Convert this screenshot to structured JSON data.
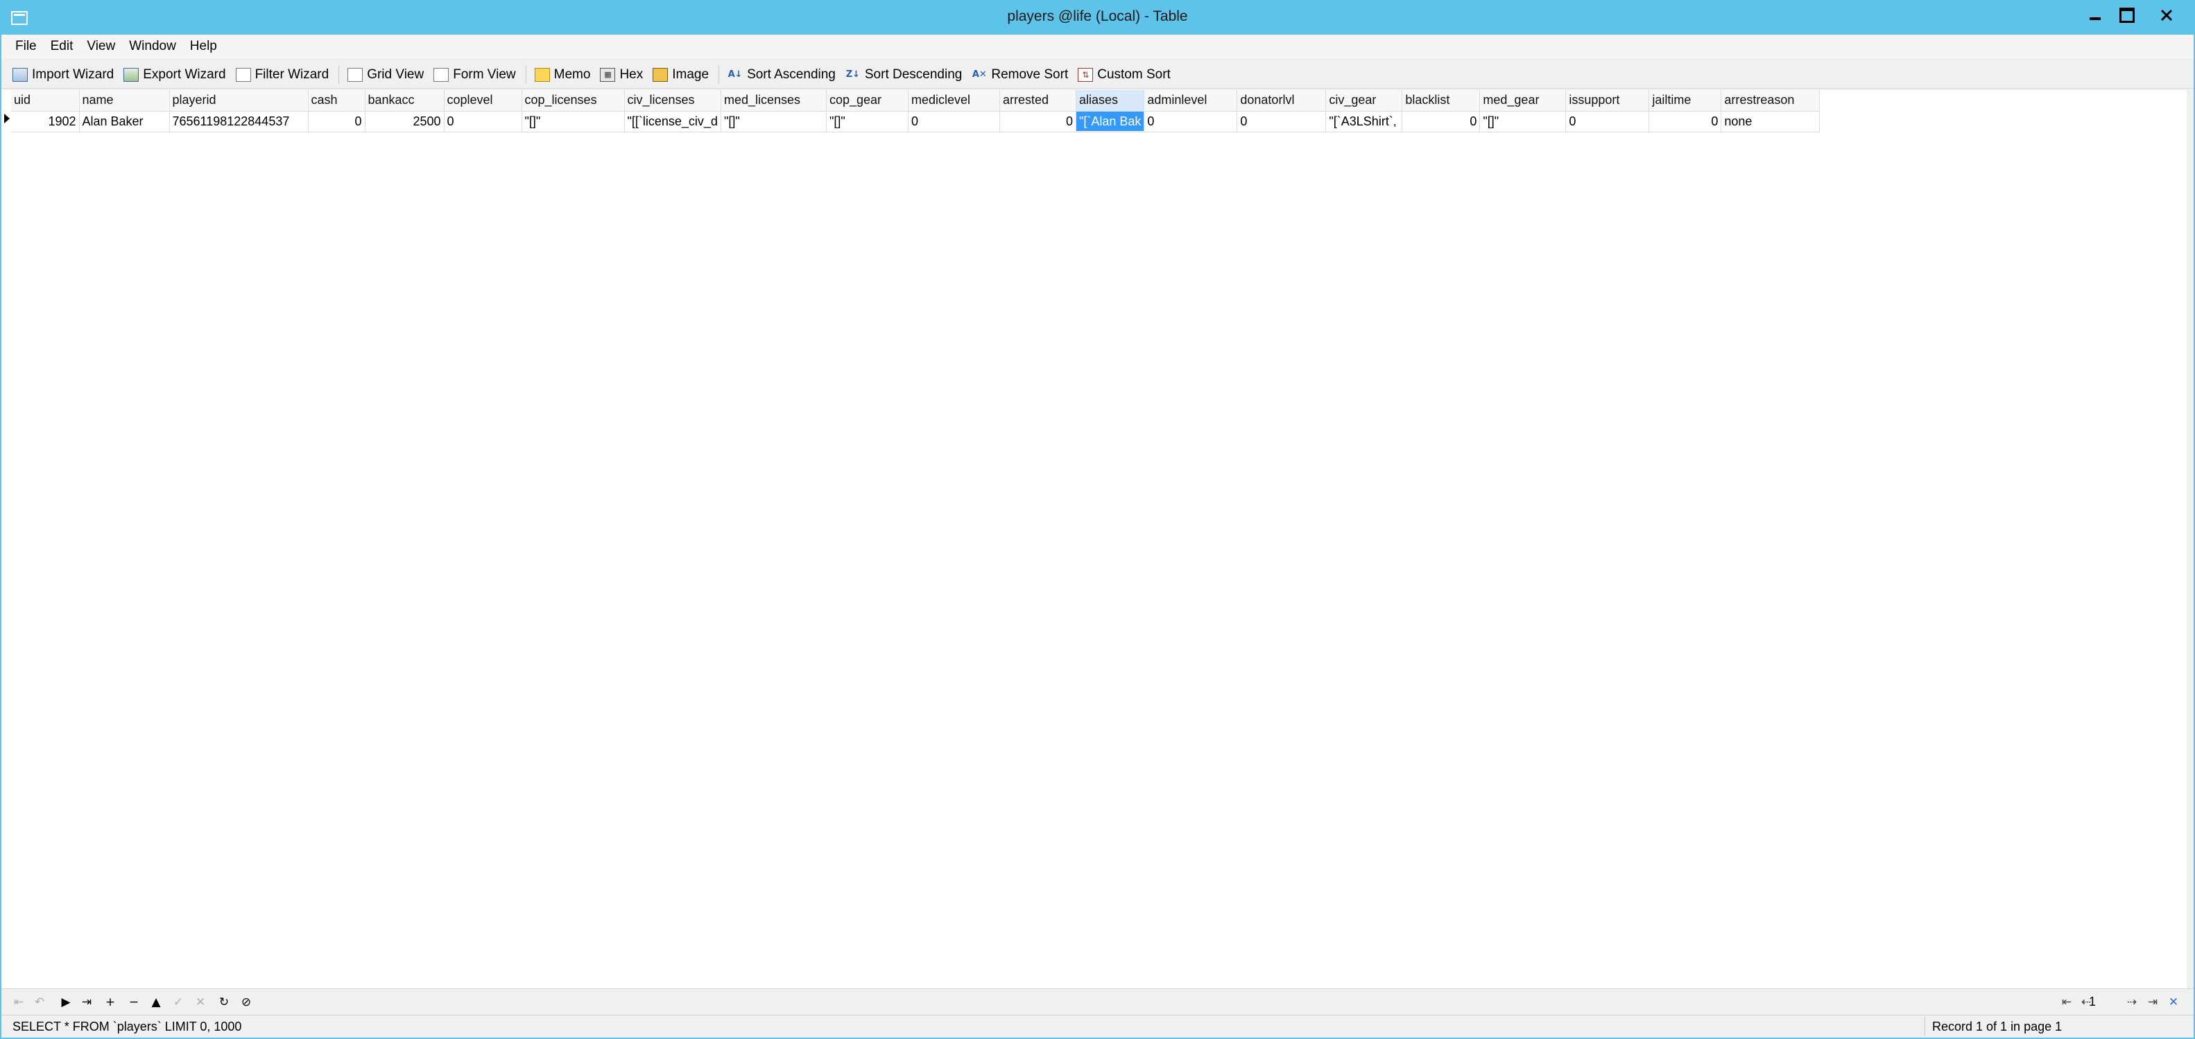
{
  "window": {
    "title": "players @life (Local) - Table"
  },
  "menu": [
    "File",
    "Edit",
    "View",
    "Window",
    "Help"
  ],
  "toolbar": {
    "import_wizard": "Import Wizard",
    "export_wizard": "Export Wizard",
    "filter_wizard": "Filter Wizard",
    "grid_view": "Grid View",
    "form_view": "Form View",
    "memo": "Memo",
    "hex": "Hex",
    "image": "Image",
    "sort_ascending": "Sort Ascending",
    "sort_descending": "Sort Descending",
    "remove_sort": "Remove Sort",
    "custom_sort": "Custom Sort"
  },
  "grid": {
    "columns": [
      "uid",
      "name",
      "playerid",
      "cash",
      "bankacc",
      "coplevel",
      "cop_licenses",
      "civ_licenses",
      "med_licenses",
      "cop_gear",
      "mediclevel",
      "arrested",
      "aliases",
      "adminlevel",
      "donatorlvl",
      "civ_gear",
      "blacklist",
      "med_gear",
      "issupport",
      "jailtime",
      "arrestreason"
    ],
    "rows": [
      {
        "uid": "1902",
        "name": "Alan Baker",
        "playerid": "76561198122844537",
        "cash": "0",
        "bankacc": "2500",
        "coplevel": "0",
        "cop_licenses": "\"[]\"",
        "civ_licenses": "\"[[`license_civ_d",
        "med_licenses": "\"[]\"",
        "cop_gear": "\"[]\"",
        "mediclevel": "0",
        "arrested": "0",
        "aliases": "\"[`Alan Bak",
        "adminlevel": "0",
        "donatorlvl": "0",
        "civ_gear": "\"[`A3LShirt`,",
        "blacklist": "0",
        "med_gear": "\"[]\"",
        "issupport": "0",
        "jailtime": "0",
        "arrestreason": "none"
      }
    ]
  },
  "navigation": {
    "page": "1"
  },
  "status": {
    "sql": "SELECT * FROM `players` LIMIT 0, 1000",
    "record_info": "Record 1 of 1 in page 1"
  }
}
